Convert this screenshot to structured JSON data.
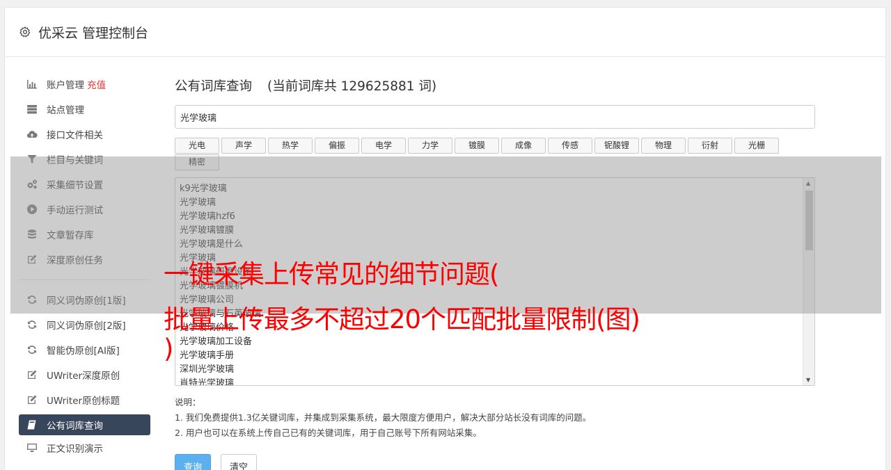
{
  "header": {
    "title": "优采云 管理控制台"
  },
  "sidebar": {
    "items": [
      {
        "label": "账户管理",
        "badge": "充值",
        "icon": "bar-chart-icon"
      },
      {
        "label": "站点管理",
        "icon": "server-icon"
      },
      {
        "label": "接口文件相关",
        "icon": "cloud-upload-icon"
      },
      {
        "label": "栏目与关键词",
        "icon": "filter-icon"
      },
      {
        "label": "采集细节设置",
        "icon": "gears-icon"
      },
      {
        "label": "手动运行测试",
        "icon": "play-circle-icon"
      },
      {
        "label": "文章暂存库",
        "icon": "database-icon"
      },
      {
        "label": "深度原创任务",
        "icon": "edit-icon"
      },
      {
        "label": "同义词伪原创[1版]",
        "icon": "refresh-icon"
      },
      {
        "label": "同义词伪原创[2版]",
        "icon": "refresh-icon"
      },
      {
        "label": "智能伪原创[AI版]",
        "icon": "refresh-icon"
      },
      {
        "label": "UWriter深度原创",
        "icon": "edit-icon"
      },
      {
        "label": "UWriter原创标题",
        "icon": "edit-icon"
      },
      {
        "label": "公有词库查询",
        "icon": "book-icon"
      },
      {
        "label": "正文识别演示",
        "icon": "monitor-icon"
      }
    ]
  },
  "main": {
    "title": "公有词库查询",
    "count_text": "(当前词库共 129625881 词)",
    "search_value": "光学玻璃",
    "tags": [
      "光电",
      "声学",
      "热学",
      "偏振",
      "电学",
      "力学",
      "镀膜",
      "成像",
      "传感",
      "铌酸锂",
      "物理",
      "衍射",
      "光栅",
      "精密"
    ],
    "results": [
      "k9光学玻璃",
      "光学玻璃",
      "光学玻璃hzf6",
      "光学玻璃镀膜",
      "光学玻璃是什么",
      "光学玻璃",
      "光学玻璃研磨设备",
      "光学玻璃镀膜机",
      "光学玻璃公司",
      "光学玻璃与石英玻璃",
      "光学玻璃价格",
      "光学玻璃加工设备",
      "光学玻璃手册",
      "深圳光学玻璃",
      "肖特光学玻璃"
    ],
    "notes_title": "说明：",
    "notes": [
      "1. 我们免费提供1.3亿关键词库，并集成到采集系统，最大限度方便用户，解决大部分站长没有词库的问题。",
      "2. 用户也可以在系统上传自己已有的关键词库，用于自己账号下所有网站采集。"
    ],
    "query_button": "查询",
    "clear_button": "清空"
  },
  "overlay": {
    "headline_line1": "一键采集上传常见的细节问题(",
    "headline_line2": "批量上传最多不超过20个匹配批量限制(图)",
    "headline_line3": ")"
  },
  "colors": {
    "sidebar_active": "#37465a",
    "primary": "#5bb0f0",
    "headline": "#ff0000",
    "recharge": "#ee3333"
  }
}
